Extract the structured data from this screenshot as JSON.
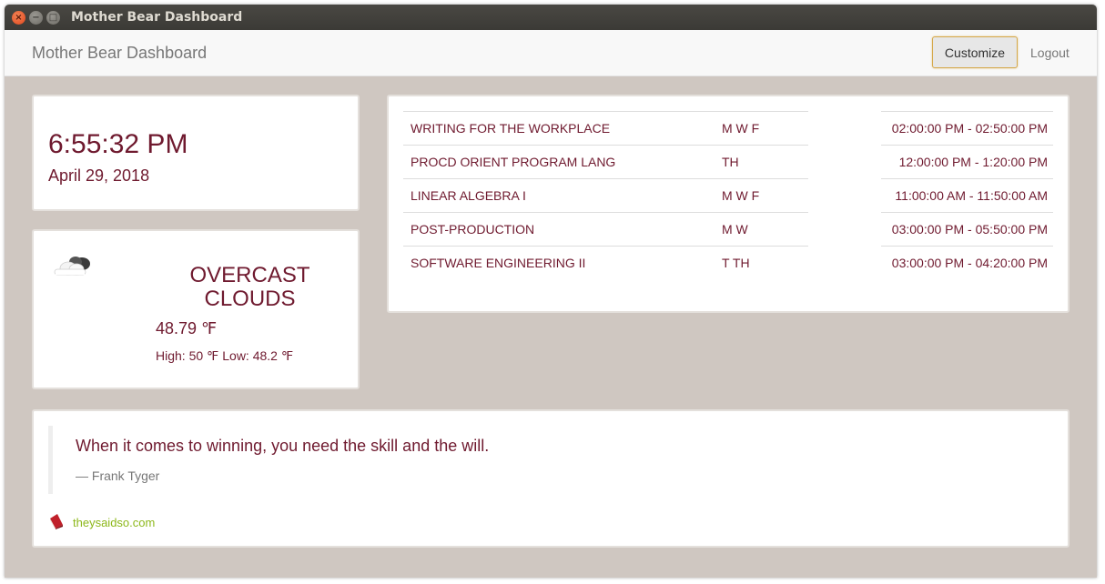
{
  "window": {
    "title": "Mother Bear Dashboard",
    "controls": {
      "close": "×",
      "minimize": "−",
      "maximize": "□"
    }
  },
  "navbar": {
    "brand": "Mother Bear Dashboard",
    "customize_label": "Customize",
    "logout_label": "Logout"
  },
  "clock": {
    "time": "6:55:32 PM",
    "date": "April 29, 2018"
  },
  "weather": {
    "icon": "overcast-clouds-icon",
    "condition": "OVERCAST CLOUDS",
    "temperature": "48.79 ℉",
    "high_low": "High: 50 ℉ Low: 48.2 ℉"
  },
  "schedule": {
    "rows": [
      {
        "course": "WRITING FOR THE WORKPLACE",
        "days": "M W F",
        "time": "02:00:00 PM - 02:50:00 PM"
      },
      {
        "course": "PROCD ORIENT PROGRAM LANG",
        "days": "TH",
        "time": "12:00:00 PM - 1:20:00 PM"
      },
      {
        "course": "LINEAR ALGEBRA I",
        "days": "M W F",
        "time": "11:00:00 AM - 11:50:00 AM"
      },
      {
        "course": "POST-PRODUCTION",
        "days": "M W",
        "time": "03:00:00 PM - 05:50:00 PM"
      },
      {
        "course": "SOFTWARE ENGINEERING II",
        "days": "T TH",
        "time": "03:00:00 PM - 04:20:00 PM"
      }
    ]
  },
  "quote": {
    "text": "When it comes to winning, you need the skill and the will.",
    "author": "— Frank Tyger",
    "source_icon": "book-icon",
    "source_label": "theysaidso.com"
  },
  "colors": {
    "accent_text": "#6f1a2f",
    "background": "#cfc7c1",
    "link": "#8db81b"
  }
}
